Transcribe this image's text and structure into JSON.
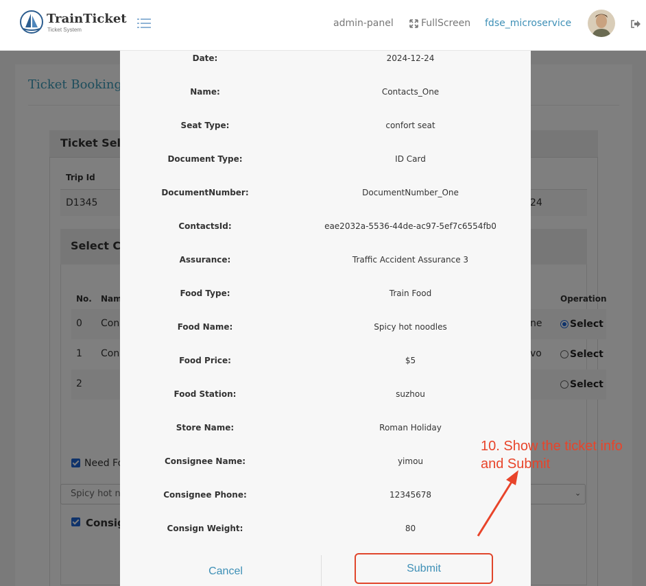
{
  "header": {
    "brand": "TrainTicket",
    "brand_sub": "Ticket System",
    "nav": [
      "admin-panel",
      "FullScreen",
      "fdse_microservice"
    ],
    "accent": "#3d8fb6"
  },
  "background": {
    "page_title": "Ticket Booking",
    "ticket_select_title": "Ticket Sele",
    "trip_header": "Trip Id",
    "trip_id": "D1345",
    "trip_tail": "24",
    "contacts_title": "Select Co",
    "columns": {
      "no": "No.",
      "name": "Nam",
      "operation": "Operation"
    },
    "rows": [
      {
        "no": "0",
        "name": "Con",
        "tail": "ne",
        "select": "Select",
        "checked": true
      },
      {
        "no": "1",
        "name": "Con",
        "tail": "vo",
        "select": "Select",
        "checked": false
      },
      {
        "no": "2",
        "name": "",
        "tail": "",
        "select": "Select",
        "checked": false
      }
    ],
    "need_food": "Need Fo",
    "food_select": "Spicy hot n",
    "consign": "Consig"
  },
  "modal": {
    "fields": [
      {
        "label": "Date:",
        "value": "2024-12-24"
      },
      {
        "label": "Name:",
        "value": "Contacts_One"
      },
      {
        "label": "Seat Type:",
        "value": "confort seat"
      },
      {
        "label": "Document Type:",
        "value": "ID Card"
      },
      {
        "label": "DocumentNumber:",
        "value": "DocumentNumber_One"
      },
      {
        "label": "ContactsId:",
        "value": "eae2032a-5536-44de-ac97-5ef7c6554fb0"
      },
      {
        "label": "Assurance:",
        "value": "Traffic Accident Assurance 3"
      },
      {
        "label": "Food Type:",
        "value": "Train Food"
      },
      {
        "label": "Food Name:",
        "value": "Spicy hot noodles"
      },
      {
        "label": "Food Price:",
        "value": "$5"
      },
      {
        "label": "Food Station:",
        "value": "suzhou"
      },
      {
        "label": "Store Name:",
        "value": "Roman Holiday"
      },
      {
        "label": "Consignee Name:",
        "value": "yimou"
      },
      {
        "label": "Consignee Phone:",
        "value": "12345678"
      },
      {
        "label": "Consign Weight:",
        "value": "80"
      }
    ],
    "cancel_label": "Cancel",
    "submit_label": "Submit"
  },
  "annotation": {
    "line1": "10. Show the ticket info",
    "line2": "and Submit",
    "color": "#e8442a"
  }
}
